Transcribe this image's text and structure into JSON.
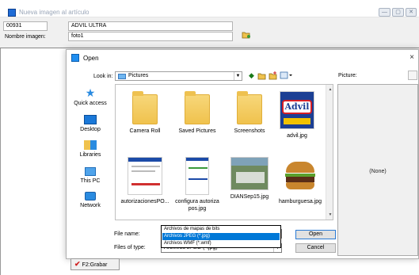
{
  "outer_window": {
    "title": "Nueva imagen al artículo",
    "minimize": "—",
    "maximize": "▢",
    "close": "✕"
  },
  "form": {
    "code_value": "00931",
    "name_value": "ADVIL ULTRA",
    "image_label": "Nombre imagen:",
    "image_value": "foto1"
  },
  "dialog": {
    "title": "Open",
    "close": "×",
    "lookin_label": "Look in:",
    "lookin_value": "Pictures",
    "preview_label": "Picture:",
    "preview_none": "(None)",
    "places": [
      {
        "label": "Quick access",
        "icon": "star-icon"
      },
      {
        "label": "Desktop",
        "icon": "desktop-icon"
      },
      {
        "label": "Libraries",
        "icon": "libraries-icon"
      },
      {
        "label": "This PC",
        "icon": "computer-icon"
      },
      {
        "label": "Network",
        "icon": "network-icon"
      }
    ],
    "files": [
      {
        "label": "Camera Roll",
        "type": "folder"
      },
      {
        "label": "Saved Pictures",
        "type": "folder"
      },
      {
        "label": "Screenshots",
        "type": "folder"
      },
      {
        "label": "advil.jpg",
        "type": "image",
        "thumb_text": "Advil"
      },
      {
        "label": "autorizacionesPO...",
        "type": "image"
      },
      {
        "label": "configura autoriza pos.jpg",
        "type": "image"
      },
      {
        "label": "DIANSep15.jpg",
        "type": "image"
      },
      {
        "label": "hamburguesa.jpg",
        "type": "image"
      }
    ],
    "filename_label": "File name:",
    "filename_value": "",
    "filetype_label": "Files of type:",
    "filetype_value": "Archivos JPEG (*.jpg)",
    "filetype_options": [
      "Archivos de mapas de bits",
      "Archivos JPEG (*.jpg)",
      "Archivos WMF (*.wmf)"
    ],
    "open_button": "Open",
    "cancel_button": "Cancel"
  },
  "grabar_button": "F2:Grabar",
  "colors": {
    "accent": "#0078d7",
    "folder": "#f0c24d",
    "advil_blue": "#1c3f94"
  }
}
